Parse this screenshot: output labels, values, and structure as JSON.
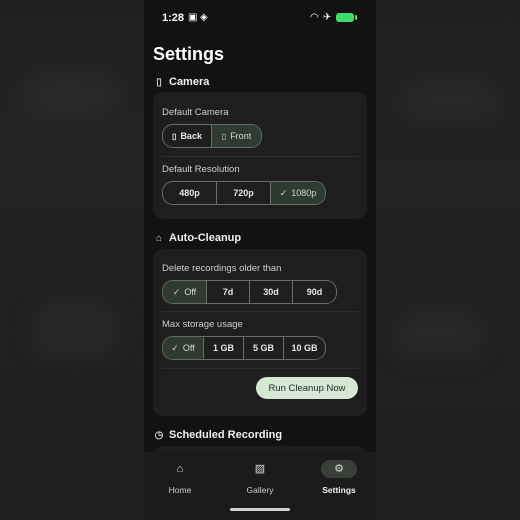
{
  "status": {
    "time": "1:28",
    "icons": [
      "photo-icon",
      "location-icon",
      "wifi-icon",
      "airplane-icon",
      "battery-icon"
    ]
  },
  "page": {
    "title": "Settings"
  },
  "camera": {
    "heading": "Camera",
    "default_camera_label": "Default Camera",
    "camera_options": [
      "Back",
      "Front"
    ],
    "camera_selected": "Front",
    "default_resolution_label": "Default Resolution",
    "resolution_options": [
      "480p",
      "720p",
      "1080p"
    ],
    "resolution_selected": "1080p"
  },
  "cleanup": {
    "heading": "Auto-Cleanup",
    "delete_label": "Delete recordings older than",
    "delete_options": [
      "Off",
      "7d",
      "30d",
      "90d"
    ],
    "delete_selected": "Off",
    "storage_label": "Max storage usage",
    "storage_options": [
      "Off",
      "1 GB",
      "5 GB",
      "10 GB"
    ],
    "storage_selected": "Off",
    "run_button": "Run Cleanup Now"
  },
  "scheduled": {
    "heading": "Scheduled Recording"
  },
  "nav": {
    "items": [
      {
        "label": "Home",
        "icon": "home-icon",
        "active": false
      },
      {
        "label": "Gallery",
        "icon": "gallery-icon",
        "active": false
      },
      {
        "label": "Settings",
        "icon": "gear-icon",
        "active": true
      }
    ]
  },
  "colors": {
    "accent_button": "#d6e7d4",
    "selected_segment": "#2f3a30",
    "battery": "#3ddc6b",
    "background": "#121212",
    "card": "#1e1e1e"
  }
}
